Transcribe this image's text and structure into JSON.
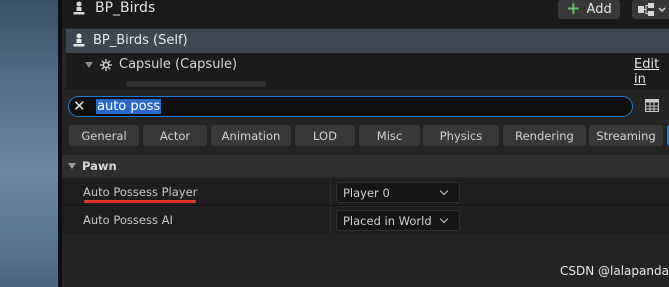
{
  "header": {
    "title": "BP_Birds",
    "add_label": "Add"
  },
  "components": {
    "self_label": "BP_Birds (Self)",
    "capsule_label": "Capsule (Capsule)",
    "edit_link": "Edit in"
  },
  "search": {
    "value": "auto poss"
  },
  "filters": [
    "General",
    "Actor",
    "Animation",
    "LOD",
    "Misc",
    "Physics",
    "Rendering",
    "Streaming"
  ],
  "section": {
    "label": "Pawn"
  },
  "properties": [
    {
      "name": "Auto Possess Player",
      "value": "Player 0"
    },
    {
      "name": "Auto Possess AI",
      "value": "Placed in World"
    }
  ],
  "watermark": "CSDN @lalapanda",
  "colors": {
    "accent": "#1f7ad8",
    "selection": "#2a68c8",
    "annotation": "#e0322c",
    "add_icon": "#5fc05f"
  }
}
